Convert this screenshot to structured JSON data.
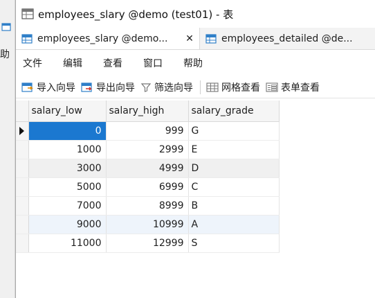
{
  "window": {
    "title": "employees_slary @demo (test01) - 表"
  },
  "tabs": [
    {
      "label": "employees_slary @demo...",
      "close": "✕",
      "active": true
    },
    {
      "label": "employees_detailed @de...",
      "active": false
    }
  ],
  "menu": [
    "文件",
    "编辑",
    "查看",
    "窗口",
    "帮助"
  ],
  "toolbar": {
    "import": "导入向导",
    "export": "导出向导",
    "filter": "筛选向导",
    "grid_view": "网格查看",
    "form_view": "表单查看"
  },
  "background_window": {
    "glyph": "助"
  },
  "table": {
    "columns": [
      "salary_low",
      "salary_high",
      "salary_grade"
    ],
    "rows": [
      {
        "salary_low": "0",
        "salary_high": "999",
        "salary_grade": "G"
      },
      {
        "salary_low": "1000",
        "salary_high": "2999",
        "salary_grade": "E"
      },
      {
        "salary_low": "3000",
        "salary_high": "4999",
        "salary_grade": "D"
      },
      {
        "salary_low": "5000",
        "salary_high": "6999",
        "salary_grade": "C"
      },
      {
        "salary_low": "7000",
        "salary_high": "8999",
        "salary_grade": "B"
      },
      {
        "salary_low": "9000",
        "salary_high": "10999",
        "salary_grade": "A"
      },
      {
        "salary_low": "11000",
        "salary_high": "12999",
        "salary_grade": "S"
      }
    ]
  },
  "colors": {
    "selection": "#1b78d0",
    "accent_icon": "#2f7fc8"
  }
}
